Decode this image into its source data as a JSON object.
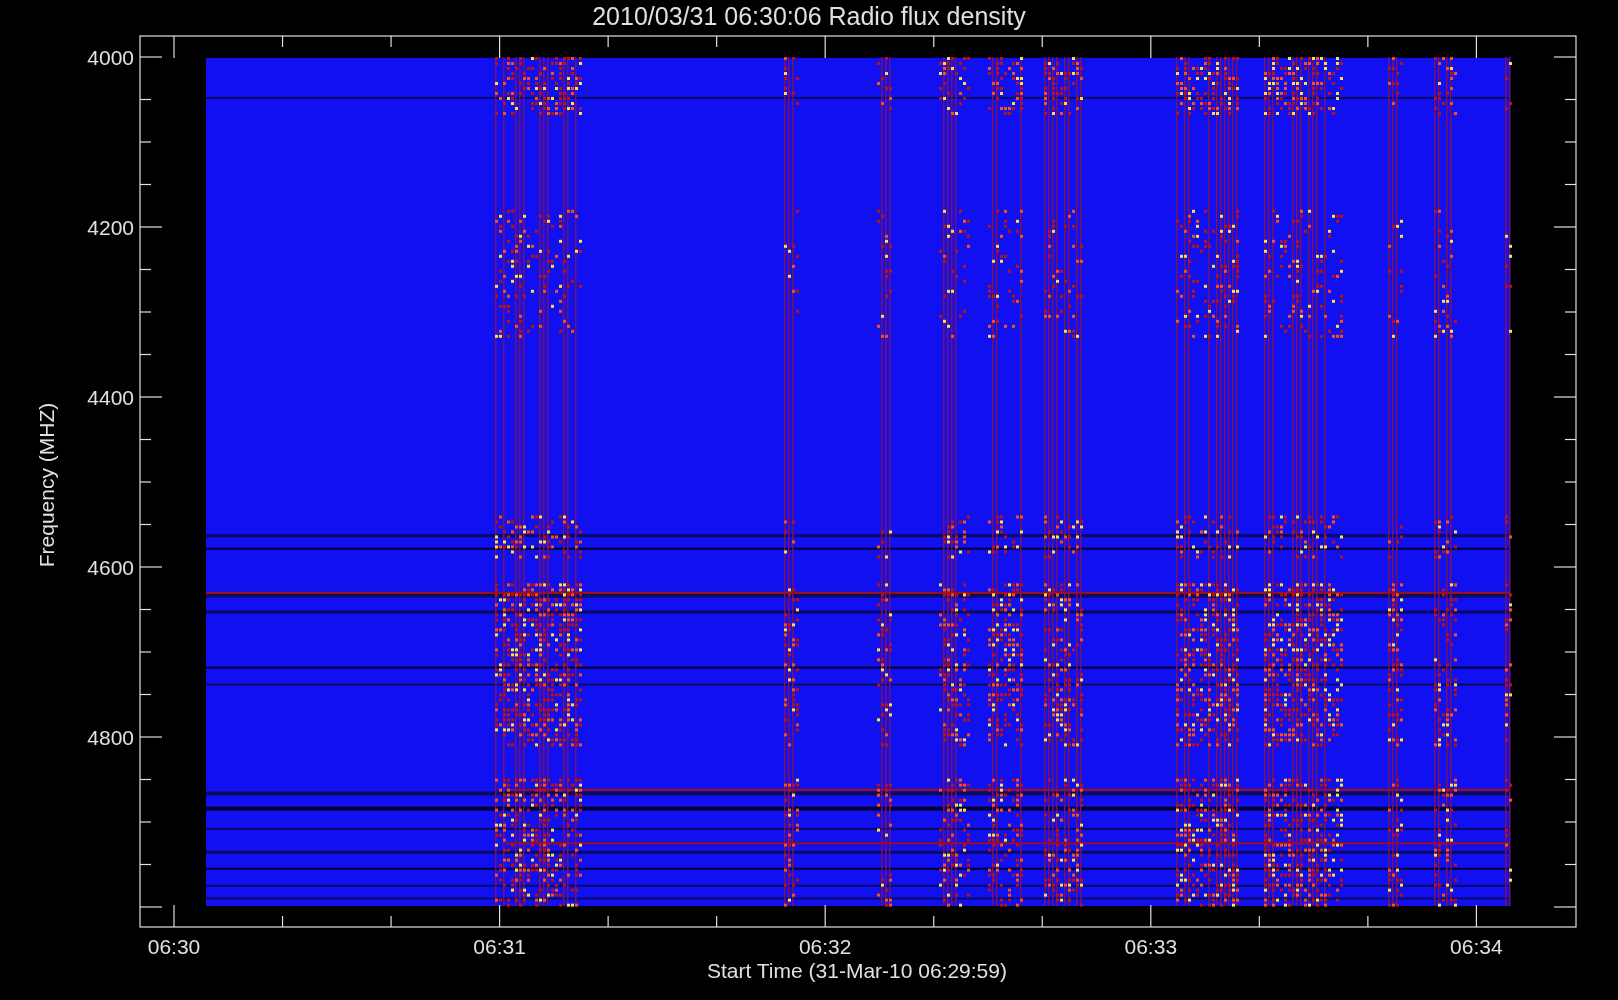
{
  "title": "2010/03/31 06:30:06 Radio flux density",
  "plot": {
    "y_axis": {
      "label": "Frequency (MHZ)",
      "ticks": [
        "4000",
        "4200",
        "4400",
        "4600",
        "4800"
      ]
    },
    "x_axis": {
      "label": "Start Time (31-Mar-10 06:29:59)",
      "ticks": [
        "06:30",
        "06:31",
        "06:32",
        "06:33",
        "06:34"
      ]
    }
  }
}
